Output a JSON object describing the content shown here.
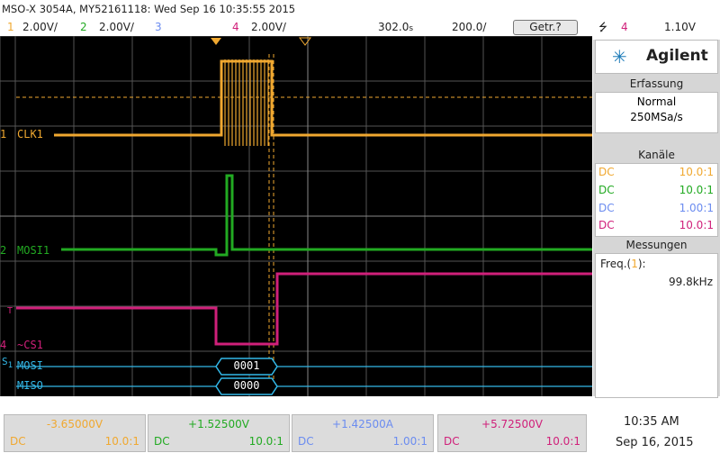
{
  "header": {
    "title": "MSO-X 3054A, MY52161118: Wed Sep 16 10:35:55 2015"
  },
  "channels_bar": {
    "ch1_num": "1",
    "ch1_scale": "2.00V/",
    "ch2_num": "2",
    "ch2_scale": "2.00V/",
    "ch3_num": "3",
    "ch4_num": "4",
    "ch4_scale": "2.00V/",
    "timebase": "302.0",
    "timebase_unit": "s",
    "delay": "200.0",
    "delay_unit": "/",
    "run_state": "Getr.?",
    "trigger_channel": "4",
    "trigger_level": "1.10V"
  },
  "trace_labels": {
    "ch1": "CLK1",
    "ch2": "MOSI1",
    "ch4": "~CS1",
    "serial_mosi": "MOSI",
    "serial_miso": "MISO",
    "mosi_value": "0001",
    "miso_value": "0000",
    "ch1_marker": "1",
    "ch2_marker": "2",
    "ch4_marker": "4",
    "trig_marker": "T",
    "serial_marker": "S",
    "serial_marker_sub": "1"
  },
  "sidebar": {
    "brand": "Agilent",
    "acq_title": "Erfassung",
    "acq_mode": "Normal",
    "acq_rate": "250MSa/s",
    "chan_title": "Kanäle",
    "channels": [
      {
        "coupling": "DC",
        "probe": "10.0:1",
        "color": "#f0a830"
      },
      {
        "coupling": "DC",
        "probe": "10.0:1",
        "color": "#22aa22"
      },
      {
        "coupling": "DC",
        "probe": "1.00:1",
        "color": "#6b8cf0"
      },
      {
        "coupling": "DC",
        "probe": "10.0:1",
        "color": "#d0207a"
      }
    ],
    "meas_title": "Messungen",
    "meas_label": "Freq.(",
    "meas_ch": "1",
    "meas_label_end": "):",
    "meas_value": "99.8kHz"
  },
  "bottom": {
    "cells": [
      {
        "value": "-3.65000V",
        "coupling": "DC",
        "probe": "10.0:1",
        "color": "#f0a830"
      },
      {
        "value": "+1.52500V",
        "coupling": "DC",
        "probe": "10.0:1",
        "color": "#22aa22"
      },
      {
        "value": "+1.42500A",
        "coupling": "DC",
        "probe": "1.00:1",
        "color": "#6b8cf0"
      },
      {
        "value": "+5.72500V",
        "coupling": "DC",
        "probe": "10.0:1",
        "color": "#d0207a"
      }
    ],
    "time": "10:35 AM",
    "date": "Sep 16, 2015"
  },
  "colors": {
    "ch1": "#f0a830",
    "ch2": "#22aa22",
    "ch3": "#6b8cf0",
    "ch4": "#d0207a",
    "serial": "#33b8e8"
  }
}
